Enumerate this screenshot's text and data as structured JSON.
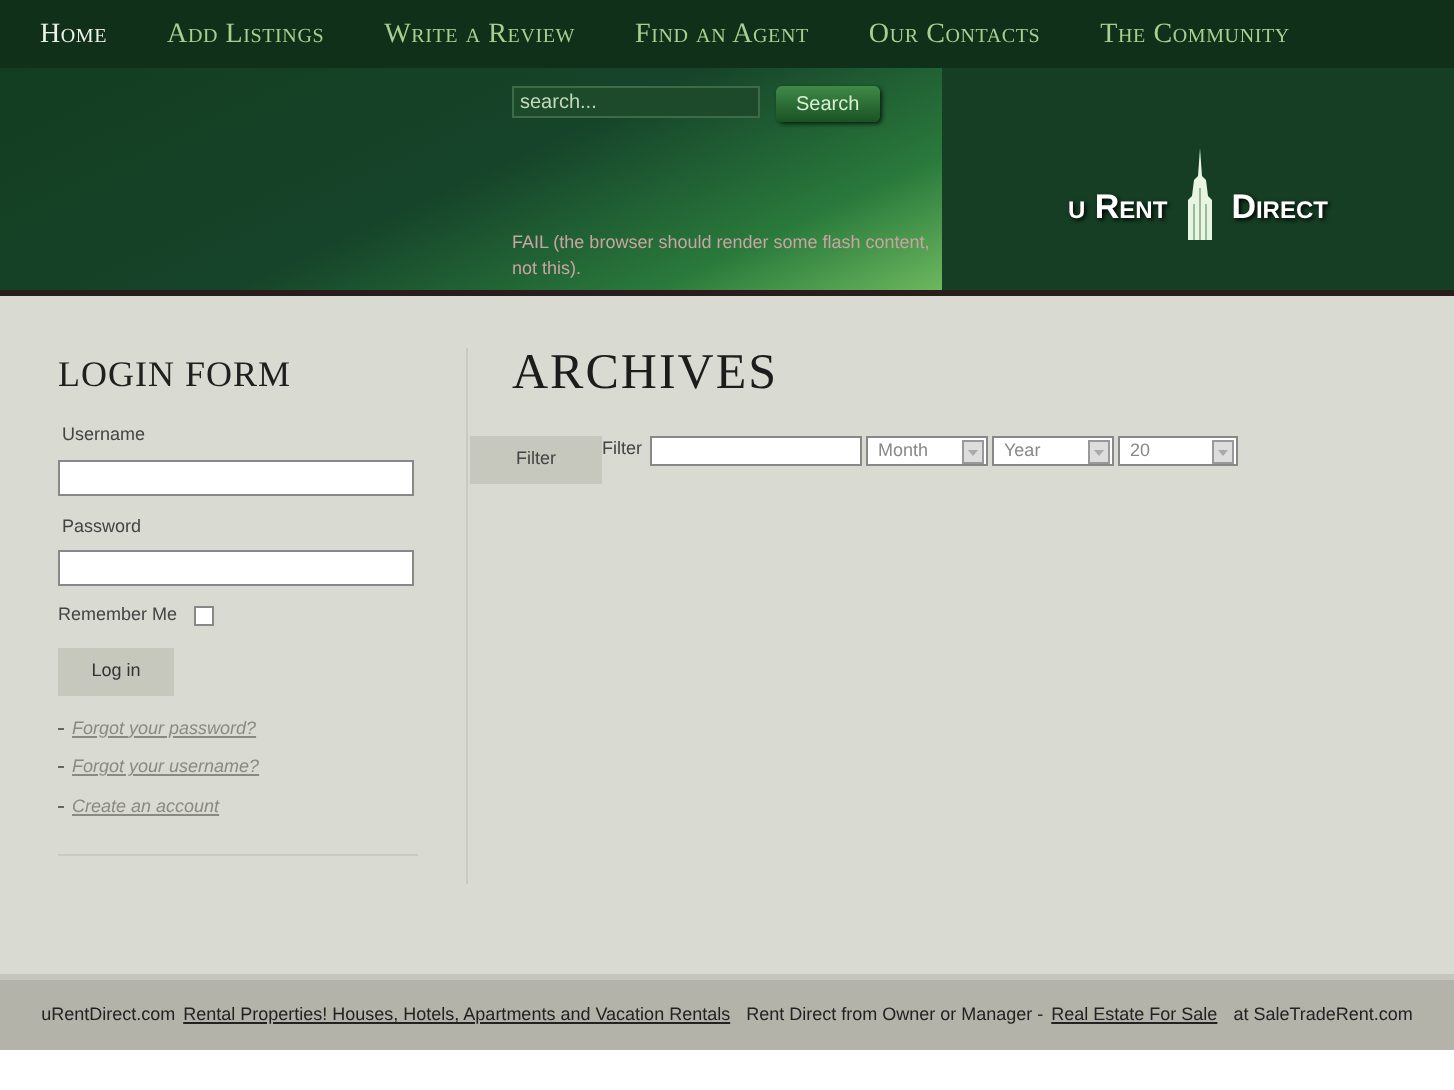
{
  "nav": [
    {
      "label": "Home",
      "selected": true
    },
    {
      "label": "Add Listings",
      "selected": false
    },
    {
      "label": "Write a Review",
      "selected": false
    },
    {
      "label": "Find an Agent",
      "selected": false
    },
    {
      "label": "Our Contacts",
      "selected": false
    },
    {
      "label": "The Community",
      "selected": false
    }
  ],
  "header": {
    "search": {
      "placeholder": "search..."
    },
    "search_button": "Search",
    "flash_message": "FAIL (the browser should render some flash content, not this).",
    "logo": {
      "left": "u Rent",
      "right": "Direct"
    }
  },
  "login": {
    "title": "LOGIN FORM",
    "username_label": "Username",
    "password_label": "Password",
    "remember_label": "Remember Me",
    "remember_checked": false,
    "login_button": "Log in",
    "links": [
      "Forgot your password?",
      "Forgot your username?",
      "Create an account"
    ]
  },
  "archives": {
    "title": "ARCHIVES",
    "filter_button": "Filter",
    "filter_label": "Filter",
    "selects": [
      "Month",
      "Year",
      "20"
    ]
  },
  "footer": [
    {
      "kind": "text",
      "text": "uRentDirect.com"
    },
    {
      "kind": "link",
      "text": "Rental Properties! Houses, Hotels, Apartments and Vacation Rentals"
    },
    {
      "kind": "text",
      "text": "Rent Direct from Owner or Manager -"
    },
    {
      "kind": "link",
      "text": "Real Estate For Sale"
    },
    {
      "kind": "text",
      "text": "at SaleTradeRent.com"
    }
  ]
}
